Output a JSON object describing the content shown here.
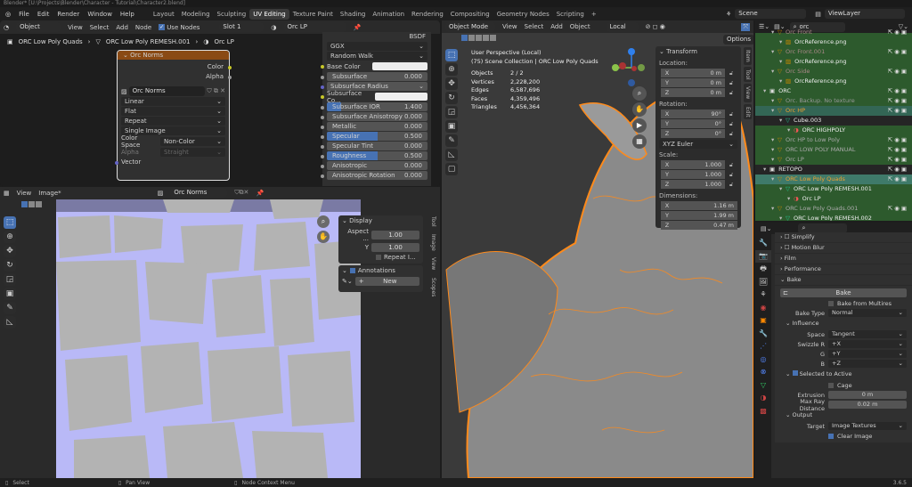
{
  "window": {
    "title": "Blender* [U:\\Projects\\Blender\\Character - Tutorial\\Character2.blend]"
  },
  "menu": [
    "File",
    "Edit",
    "Render",
    "Window",
    "Help"
  ],
  "workspaces": [
    "Layout",
    "Modeling",
    "Sculpting",
    "UV Editing",
    "Texture Paint",
    "Shading",
    "Animation",
    "Rendering",
    "Compositing",
    "Geometry Nodes",
    "Scripting",
    "+"
  ],
  "scene": "Scene",
  "view_layer": "ViewLayer",
  "node_editor": {
    "mode": "Object",
    "menus": [
      "View",
      "Select",
      "Add",
      "Node"
    ],
    "use_nodes": "Use Nodes",
    "slot": "Slot 1",
    "material": "Orc LP",
    "breadcrumb": [
      "ORC Low Poly Quads",
      "ORC Low Poly REMESH.001",
      "Orc LP"
    ],
    "node": {
      "title": "Orc Norms",
      "outputs": [
        "Color",
        "Alpha"
      ],
      "image": "Orc Norms",
      "interp": "Linear",
      "proj": "Flat",
      "ext": "Repeat",
      "source": "Single Image",
      "cs_label": "Color Space",
      "cs": "Non-Color",
      "alpha_label": "Alpha",
      "alpha": "Straight",
      "input": "Vector"
    },
    "bsdf": {
      "label": "BSDF",
      "dist": "GGX",
      "sss": "Random Walk",
      "rows": [
        {
          "l": "Base Color",
          "t": "color"
        },
        {
          "l": "Subsurface",
          "v": "0.000",
          "f": 0
        },
        {
          "l": "Subsurface Radius",
          "t": "dd"
        },
        {
          "l": "Subsurface Co...",
          "t": "color"
        },
        {
          "l": "Subsurface IOR",
          "v": "1.400",
          "f": 0.14
        },
        {
          "l": "Subsurface Anisotropy",
          "v": "0.000",
          "f": 0
        },
        {
          "l": "Metallic",
          "v": "0.000",
          "f": 0
        },
        {
          "l": "Specular",
          "v": "0.500",
          "f": 0.5
        },
        {
          "l": "Specular Tint",
          "v": "0.000",
          "f": 0
        },
        {
          "l": "Roughness",
          "v": "0.500",
          "f": 0.5
        },
        {
          "l": "Anisotropic",
          "v": "0.000",
          "f": 0
        },
        {
          "l": "Anisotropic Rotation",
          "v": "0.000",
          "f": 0
        }
      ]
    }
  },
  "image_editor": {
    "menus": [
      "View",
      "Image*"
    ],
    "image": "Orc Norms",
    "display": {
      "title": "Display",
      "aspect": "Aspect ...",
      "x": "1.00",
      "y_label": "Y",
      "y": "1.00",
      "repeat": "Repeat I..."
    },
    "annotations": {
      "title": "Annotations",
      "new": "New"
    },
    "tabs": [
      "Tool",
      "Image",
      "View",
      "Scopes"
    ]
  },
  "viewport": {
    "mode": "Object Mode",
    "menus": [
      "View",
      "Select",
      "Add",
      "Object"
    ],
    "pivot": "Local",
    "options": "Options",
    "info": {
      "title": "User Perspective (Local)",
      "collection": "(75) Scene Collection | ORC Low Poly Quads",
      "stats": [
        [
          "Objects",
          "2 / 2"
        ],
        [
          "Vertices",
          "2,228,200"
        ],
        [
          "Edges",
          "6,587,696"
        ],
        [
          "Faces",
          "4,359,496"
        ],
        [
          "Triangles",
          "4,456,364"
        ]
      ]
    },
    "transform": {
      "title": "Transform",
      "location": "Location:",
      "loc": [
        [
          "X",
          "0 m"
        ],
        [
          "Y",
          "0 m"
        ],
        [
          "Z",
          "0 m"
        ]
      ],
      "rotation": "Rotation:",
      "rot": [
        [
          "X",
          "90°"
        ],
        [
          "Y",
          "0°"
        ],
        [
          "Z",
          "0°"
        ]
      ],
      "euler": "XYZ Euler",
      "scale_label": "Scale:",
      "scale": [
        [
          "X",
          "1.000"
        ],
        [
          "Y",
          "1.000"
        ],
        [
          "Z",
          "1.000"
        ]
      ],
      "dimensions": "Dimensions:",
      "dim": [
        [
          "X",
          "1.16 m"
        ],
        [
          "Y",
          "1.99 m"
        ],
        [
          "Z",
          "0.47 m"
        ]
      ]
    },
    "tabs": [
      "Item",
      "Tool",
      "View",
      "Edit"
    ]
  },
  "outliner": {
    "search": "orc",
    "items": [
      {
        "t": "Orc Front",
        "d": 2,
        "c": "#a88"
      },
      {
        "t": "OrcReference.png",
        "d": 3,
        "c": "#eee"
      },
      {
        "t": "Orc Front.001",
        "d": 2,
        "c": "#a88"
      },
      {
        "t": "OrcReference.png",
        "d": 3,
        "c": "#eee"
      },
      {
        "t": "Orc Side",
        "d": 2,
        "c": "#a88"
      },
      {
        "t": "OrcReference.png",
        "d": 3,
        "c": "#eee"
      },
      {
        "t": "ORC",
        "d": 1,
        "c": "#eee"
      },
      {
        "t": "Orc. Backup. No texture",
        "d": 2,
        "c": "#999"
      },
      {
        "t": "Orc HP",
        "d": 2,
        "c": "#f0a030",
        "hl": 1
      },
      {
        "t": "Cube.003",
        "d": 3,
        "c": "#eee",
        "dk": 1
      },
      {
        "t": "ORC HIGHPOLY",
        "d": 4,
        "c": "#eee"
      },
      {
        "t": "Orc HP to Low Poly",
        "d": 2,
        "c": "#aaa"
      },
      {
        "t": "ORC LOW POLY MANUAL",
        "d": 2,
        "c": "#aaa"
      },
      {
        "t": "Orc LP",
        "d": 2,
        "c": "#aaa"
      },
      {
        "t": "RETOPO",
        "d": 1,
        "c": "#eee",
        "dk": 1
      },
      {
        "t": "ORC Low Poly Quads",
        "d": 2,
        "c": "#f0a030",
        "hl": 2
      },
      {
        "t": "ORC Low Poly REMESH.001",
        "d": 3,
        "c": "#eee"
      },
      {
        "t": "Orc LP",
        "d": 4,
        "c": "#eee"
      },
      {
        "t": "ORC Low Poly Quads.001",
        "d": 2,
        "c": "#aaa"
      },
      {
        "t": "ORC Low Poly REMESH.002",
        "d": 3,
        "c": "#eee"
      }
    ]
  },
  "properties": {
    "sections": [
      "Simplify",
      "Motion Blur",
      "Film",
      "Performance"
    ],
    "bake": "Bake",
    "bake_button": "Bake",
    "from_multires": "Bake from Multires",
    "bake_type_label": "Bake Type",
    "bake_type": "Normal",
    "influence": "Influence",
    "space_label": "Space",
    "space": "Tangent",
    "swizzle": [
      [
        "Swizzle R",
        "+X"
      ],
      [
        "G",
        "+Y"
      ],
      [
        "B",
        "+Z"
      ]
    ],
    "sel_active": "Selected to Active",
    "cage": "Cage",
    "extrusion_label": "Extrusion",
    "extrusion": "0 m",
    "max_ray_label": "Max Ray Distance",
    "max_ray": "0.02 m",
    "output": "Output",
    "target_label": "Target",
    "target": "Image Textures",
    "clear": "Clear Image"
  },
  "status": {
    "select": "Select",
    "pan": "Pan View",
    "context": "Node Context Menu",
    "version": "3.6.5"
  },
  "colors": {
    "accent": "#4772b3",
    "node_header": "#8a4a14",
    "outliner_bg": "#2d5a2d",
    "uv_bg": "#b9b9f7",
    "selection": "#ff8a1a"
  }
}
